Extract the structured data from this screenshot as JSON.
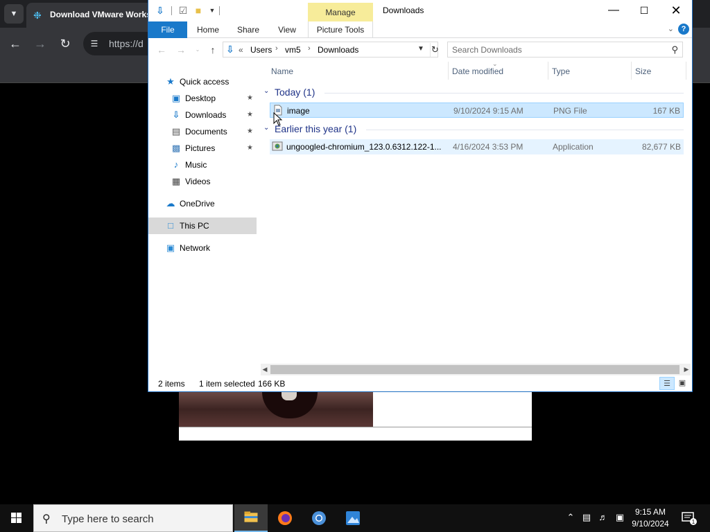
{
  "browser": {
    "tab_title": "Download VMware Works",
    "url": "https://d"
  },
  "explorer": {
    "title": "Downloads",
    "context_group": "Manage",
    "tabs": {
      "file": "File",
      "home": "Home",
      "share": "Share",
      "view": "View",
      "picture_tools": "Picture Tools"
    },
    "breadcrumb": {
      "overflow": "«",
      "items": [
        "Users",
        "vm5",
        "Downloads"
      ]
    },
    "search_placeholder": "Search Downloads",
    "nav": {
      "quick_access": "Quick access",
      "desktop": "Desktop",
      "downloads": "Downloads",
      "documents": "Documents",
      "pictures": "Pictures",
      "music": "Music",
      "videos": "Videos",
      "onedrive": "OneDrive",
      "this_pc": "This PC",
      "network": "Network"
    },
    "columns": {
      "name": "Name",
      "date": "Date modified",
      "type": "Type",
      "size": "Size"
    },
    "groups": [
      {
        "label": "Today (1)",
        "files": [
          {
            "name": "image",
            "date": "9/10/2024 9:15 AM",
            "type": "PNG File",
            "size": "167 KB"
          }
        ]
      },
      {
        "label": "Earlier this year (1)",
        "files": [
          {
            "name": "ungoogled-chromium_123.0.6312.122-1....",
            "date": "4/16/2024 3:53 PM",
            "type": "Application",
            "size": "82,677 KB"
          }
        ]
      }
    ],
    "status": {
      "items": "2 items",
      "selected": "1 item selected",
      "size": "166 KB"
    }
  },
  "taskbar": {
    "search_text": "Type here to search",
    "time": "9:15 AM",
    "date": "9/10/2024"
  },
  "colors": {
    "accent": "#1979ca",
    "selection": "#cce8ff",
    "group_header": "#1e3287",
    "manage_tab": "#f7ec9a"
  }
}
